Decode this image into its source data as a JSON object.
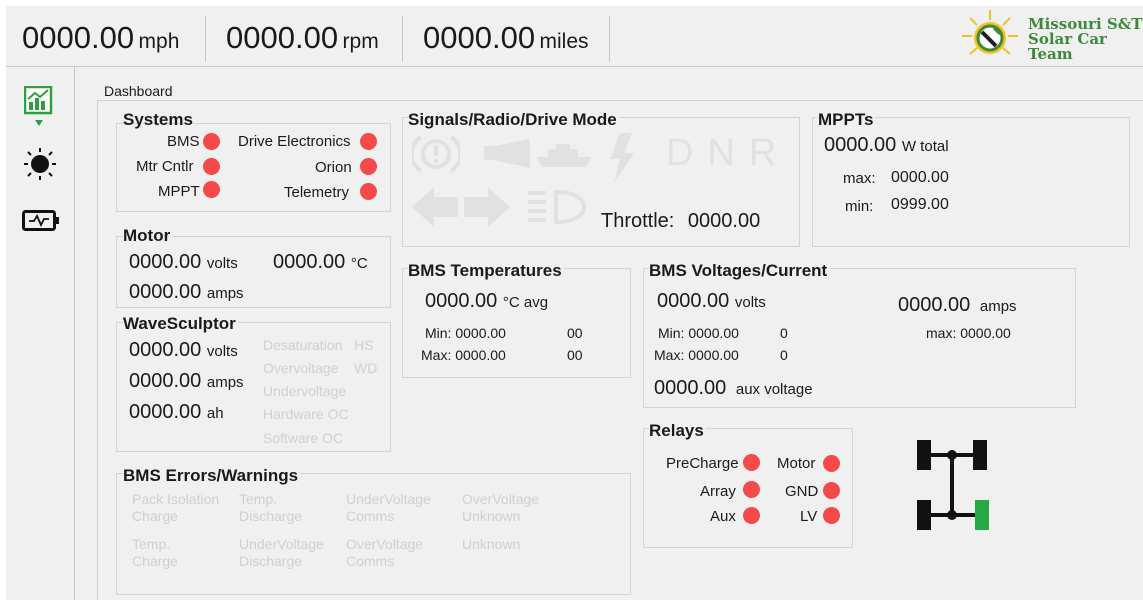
{
  "topbar": {
    "speed": {
      "value": "0000.00",
      "unit": "mph"
    },
    "rpm": {
      "value": "0000.00",
      "unit": "rpm"
    },
    "distance": {
      "value": "0000.00",
      "unit": "miles"
    },
    "logo_line1": "Missouri S&T",
    "logo_line2": "Solar Car Team"
  },
  "sidebar": {
    "items": [
      {
        "icon": "chart-icon",
        "active": true
      },
      {
        "icon": "sun-icon",
        "active": false
      },
      {
        "icon": "battery-icon",
        "active": false
      }
    ]
  },
  "tab_title": "Dashboard",
  "systems": {
    "title": "Systems",
    "items": [
      "BMS",
      "Drive Electronics",
      "Mtr Cntlr",
      "Orion",
      "MPPT",
      "Telemetry"
    ]
  },
  "signals": {
    "title": "Signals/Radio/Drive Mode",
    "icons": [
      "hazard-icon",
      "horn-icon",
      "cruise-icon",
      "regen-icon",
      "left-arrow-icon",
      "right-arrow-icon",
      "headlight-icon"
    ],
    "drive_letters": [
      "D",
      "N",
      "R"
    ],
    "throttle_label": "Throttle:",
    "throttle_value": "0000.00"
  },
  "mppts": {
    "title": "MPPTs",
    "total_value": "0000.00",
    "total_unit": "W total",
    "max_label": "max:",
    "max_value": "0000.00",
    "min_label": "min:",
    "min_value": "0999.00"
  },
  "motor": {
    "title": "Motor",
    "volts": "0000.00",
    "volts_unit": "volts",
    "temp": "0000.00",
    "temp_unit": "°C",
    "amps": "0000.00",
    "amps_unit": "amps"
  },
  "wavesculptor": {
    "title": "WaveSculptor",
    "volts": "0000.00",
    "volts_unit": "volts",
    "amps": "0000.00",
    "amps_unit": "amps",
    "ah": "0000.00",
    "ah_unit": "ah",
    "flags": [
      "Desaturation",
      "HS",
      "Overvoltage",
      "WD",
      "Undervoltage",
      "Hardware OC",
      "Software OC"
    ]
  },
  "bms_temps": {
    "title": "BMS Temperatures",
    "avg_value": "0000.00",
    "avg_unit": "°C avg",
    "min_label": "Min:",
    "min_value": "0000.00",
    "min_id": "00",
    "max_label": "Max:",
    "max_value": "0000.00",
    "max_id": "00"
  },
  "bms_voltages": {
    "title": "BMS Voltages/Current",
    "volts": "0000.00",
    "volts_unit": "volts",
    "amps": "0000.00",
    "amps_unit": "amps",
    "min_label": "Min:",
    "min_value": "0000.00",
    "min_id": "0",
    "max_label": "Max:",
    "max_value": "0000.00",
    "max_id": "0",
    "amps_max_label": "max:",
    "amps_max_value": "0000.00",
    "aux": "0000.00",
    "aux_unit": "aux voltage"
  },
  "bms_errors": {
    "title": "BMS Errors/Warnings",
    "cells": [
      [
        "Pack Isolation",
        "Charge"
      ],
      [
        "Temp.",
        "Discharge"
      ],
      [
        "UnderVoltage",
        "Comms"
      ],
      [
        "OverVoltage",
        "Unknown"
      ],
      [
        "Temp.",
        "Charge"
      ],
      [
        "UnderVoltage",
        "Discharge"
      ],
      [
        "OverVoltage",
        "Comms"
      ],
      [
        "Unknown",
        ""
      ]
    ]
  },
  "relays": {
    "title": "Relays",
    "items": [
      "PreCharge",
      "Motor",
      "Array",
      "GND",
      "Aux",
      "LV"
    ]
  },
  "colors": {
    "indicator_red": "#f44a4a",
    "indicator_green": "#28a745",
    "logo_green": "#3d8a3a",
    "logo_yellow": "#f4c020"
  }
}
